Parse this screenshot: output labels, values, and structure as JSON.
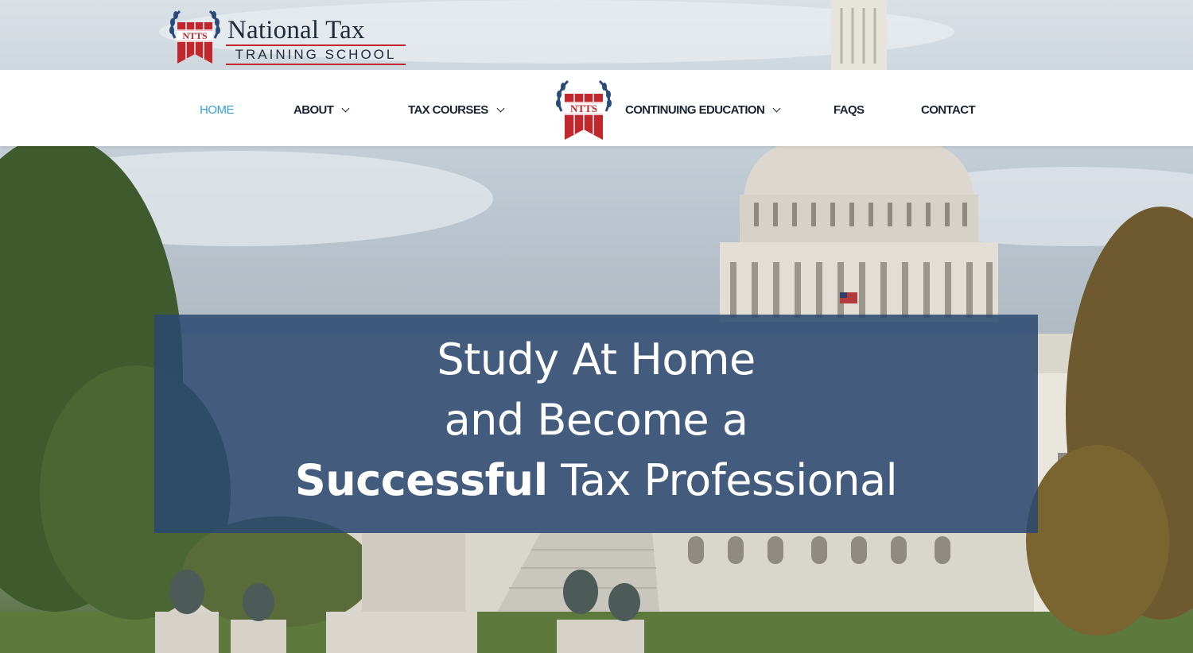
{
  "brand": {
    "name_line1": "National Tax",
    "name_line2": "TRAINING SCHOOL",
    "emblem_text": "NTTS",
    "emblem_color": "#c1272d",
    "laurel_color": "#2a4a7a"
  },
  "nav": {
    "items": [
      {
        "label": "HOME",
        "active": true,
        "has_dropdown": false
      },
      {
        "label": "ABOUT",
        "active": false,
        "has_dropdown": true
      },
      {
        "label": "TAX COURSES",
        "active": false,
        "has_dropdown": true
      },
      {
        "label": "CONTINUING EDUCATION",
        "active": false,
        "has_dropdown": true
      },
      {
        "label": "FAQS",
        "active": false,
        "has_dropdown": false
      },
      {
        "label": "CONTACT",
        "active": false,
        "has_dropdown": false
      }
    ],
    "active_color": "#3a9fd9",
    "text_color": "#1b2433"
  },
  "hero": {
    "line1": "Study At Home",
    "line2": "and Become a",
    "line3_bold": "Successful",
    "line3_rest": " Tax Professional",
    "box_color": "#2a4870"
  }
}
